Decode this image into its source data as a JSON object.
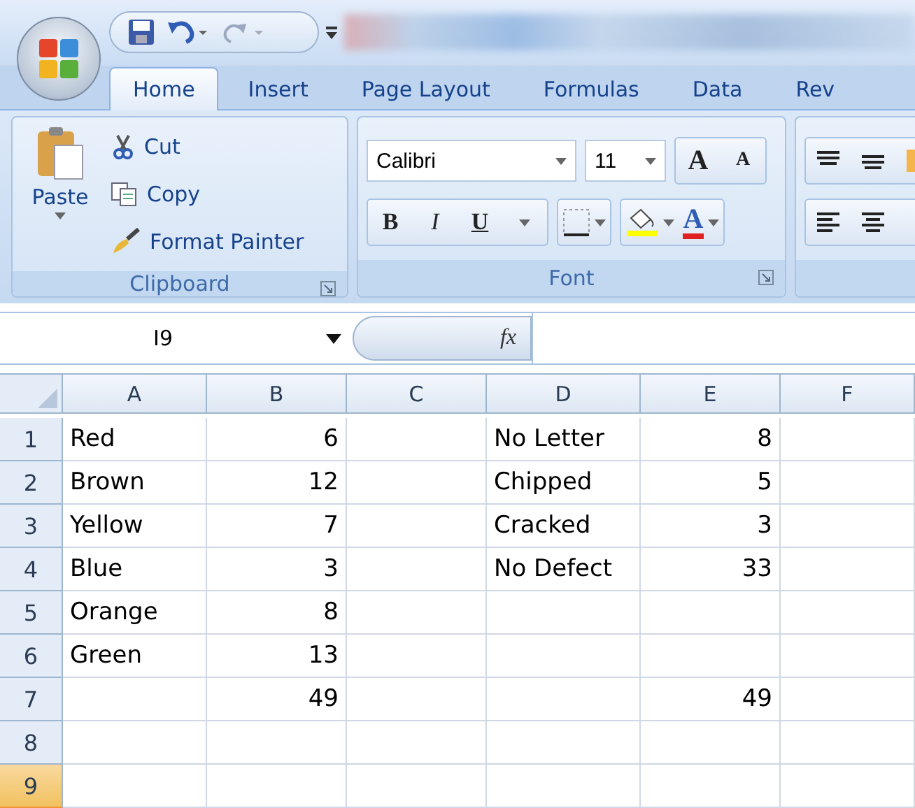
{
  "tabs": [
    {
      "label": "Home",
      "selected": true
    },
    {
      "label": "Insert",
      "selected": false
    },
    {
      "label": "Page Layout",
      "selected": false
    },
    {
      "label": "Formulas",
      "selected": false
    },
    {
      "label": "Data",
      "selected": false
    },
    {
      "label": "Rev",
      "selected": false
    }
  ],
  "ribbon": {
    "clipboard": {
      "paste": "Paste",
      "cut": "Cut",
      "copy": "Copy",
      "format_painter": "Format Painter",
      "group_label": "Clipboard"
    },
    "font": {
      "font_name": "Calibri",
      "font_size": "11",
      "grow": "A",
      "shrink": "A",
      "bold": "B",
      "italic": "I",
      "underline": "U",
      "font_color": "A",
      "group_label": "Font"
    }
  },
  "formula_bar": {
    "name_box": "I9",
    "fx": "fx"
  },
  "sheet": {
    "columns": [
      "A",
      "B",
      "C",
      "D",
      "E",
      "F"
    ],
    "rows": [
      {
        "header": "1",
        "selected": false,
        "cells": [
          {
            "value": "Red",
            "kind": "text"
          },
          {
            "value": "6",
            "kind": "number"
          },
          null,
          {
            "value": "No Letter",
            "kind": "text"
          },
          {
            "value": "8",
            "kind": "number"
          },
          null
        ]
      },
      {
        "header": "2",
        "selected": false,
        "cells": [
          {
            "value": "Brown",
            "kind": "text"
          },
          {
            "value": "12",
            "kind": "number"
          },
          null,
          {
            "value": "Chipped",
            "kind": "text"
          },
          {
            "value": "5",
            "kind": "number"
          },
          null
        ]
      },
      {
        "header": "3",
        "selected": false,
        "cells": [
          {
            "value": "Yellow",
            "kind": "text"
          },
          {
            "value": "7",
            "kind": "number"
          },
          null,
          {
            "value": "Cracked",
            "kind": "text"
          },
          {
            "value": "3",
            "kind": "number"
          },
          null
        ]
      },
      {
        "header": "4",
        "selected": false,
        "cells": [
          {
            "value": "Blue",
            "kind": "text"
          },
          {
            "value": "3",
            "kind": "number"
          },
          null,
          {
            "value": "No Defect",
            "kind": "text"
          },
          {
            "value": "33",
            "kind": "number"
          },
          null
        ]
      },
      {
        "header": "5",
        "selected": false,
        "cells": [
          {
            "value": "Orange",
            "kind": "text"
          },
          {
            "value": "8",
            "kind": "number"
          },
          null,
          null,
          null,
          null
        ]
      },
      {
        "header": "6",
        "selected": false,
        "cells": [
          {
            "value": "Green",
            "kind": "text"
          },
          {
            "value": "13",
            "kind": "number"
          },
          null,
          null,
          null,
          null
        ]
      },
      {
        "header": "7",
        "selected": false,
        "cells": [
          null,
          {
            "value": "49",
            "kind": "number"
          },
          null,
          null,
          {
            "value": "49",
            "kind": "number"
          },
          null
        ]
      },
      {
        "header": "8",
        "selected": false,
        "cells": [
          null,
          null,
          null,
          null,
          null,
          null
        ]
      },
      {
        "header": "9",
        "selected": true,
        "cells": [
          null,
          null,
          null,
          null,
          null,
          null
        ]
      }
    ]
  }
}
